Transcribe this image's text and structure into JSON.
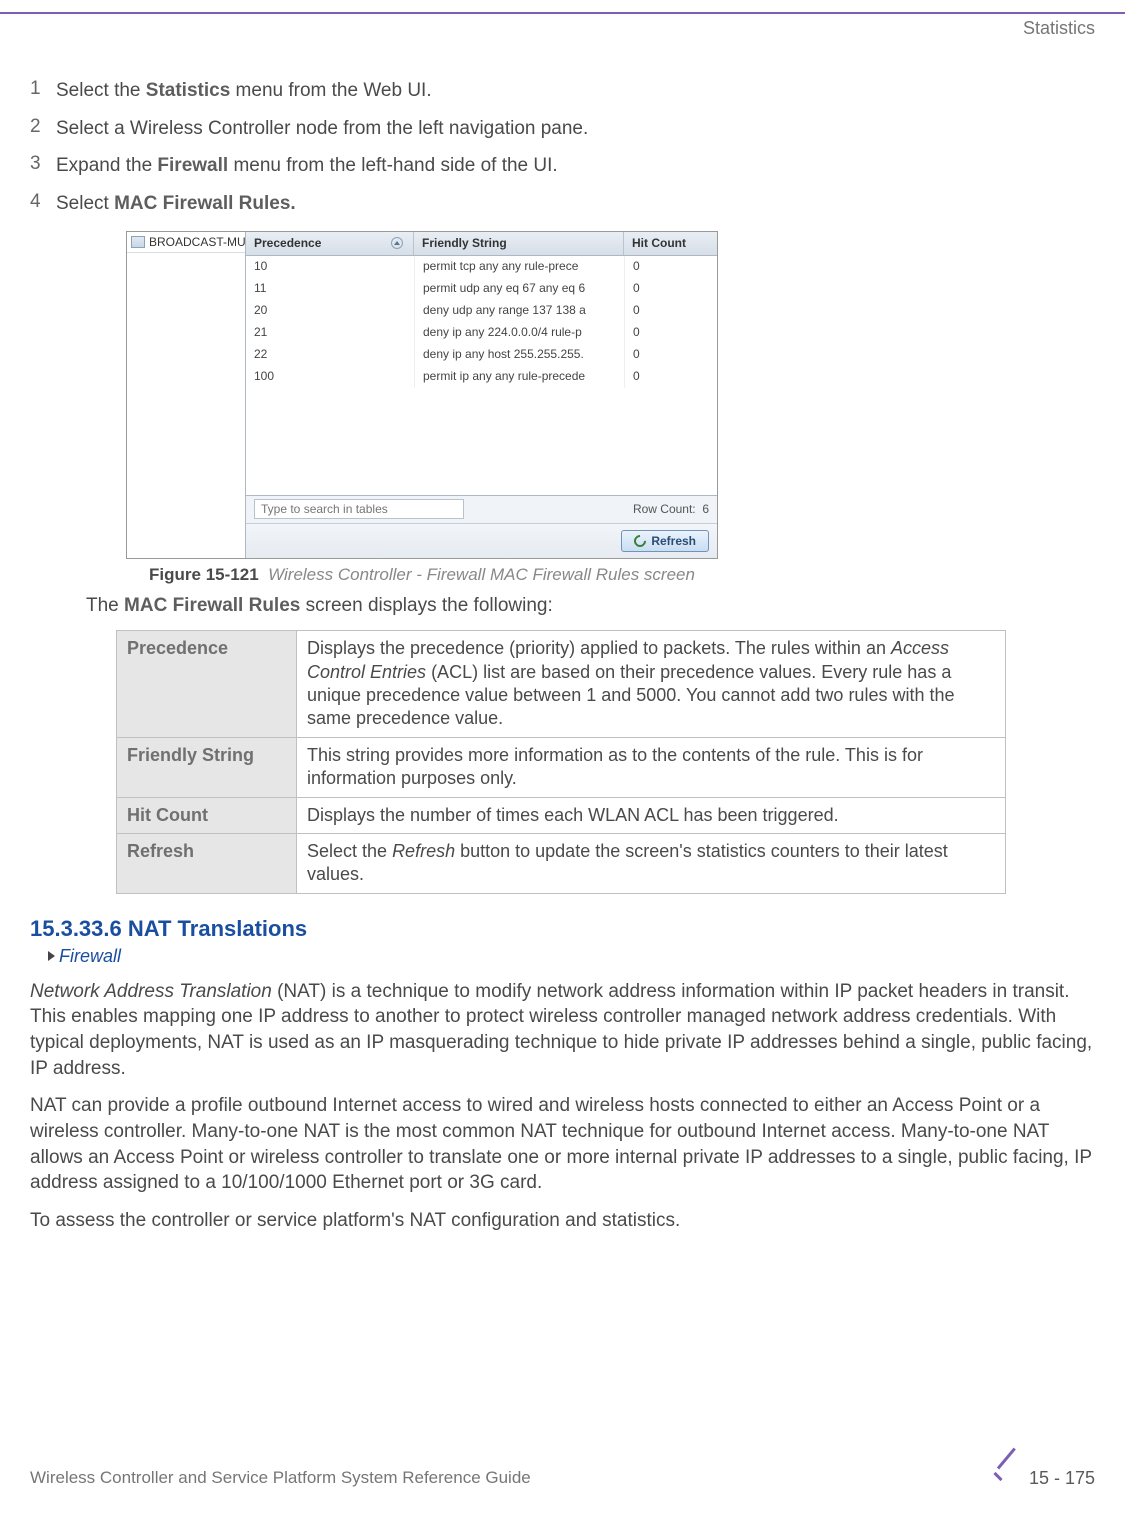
{
  "header": {
    "category": "Statistics"
  },
  "steps": [
    {
      "n": "1",
      "pre": "Select the ",
      "bold": "Statistics",
      "post": " menu from the Web UI."
    },
    {
      "n": "2",
      "pre": "Select a Wireless Controller node from the left navigation pane.",
      "bold": "",
      "post": ""
    },
    {
      "n": "3",
      "pre": "Expand the ",
      "bold": "Firewall",
      "post": " menu from the left-hand side of the UI."
    },
    {
      "n": "4",
      "pre": "Select ",
      "bold": "MAC Firewall Rules.",
      "post": ""
    }
  ],
  "figure": {
    "tree_item": "BROADCAST-MULTIC",
    "columns": {
      "c1": "Precedence",
      "c2": "Friendly String",
      "c3": "Hit Count"
    },
    "rows": [
      {
        "p": "10",
        "f": "permit tcp any any rule-prece",
        "h": "0"
      },
      {
        "p": "11",
        "f": "permit udp any eq 67 any eq 6",
        "h": "0"
      },
      {
        "p": "20",
        "f": "deny udp any range 137 138 a",
        "h": "0"
      },
      {
        "p": "21",
        "f": "deny ip any 224.0.0.0/4 rule-p",
        "h": "0"
      },
      {
        "p": "22",
        "f": "deny ip any host 255.255.255.",
        "h": "0"
      },
      {
        "p": "100",
        "f": "permit ip any any rule-precede",
        "h": "0"
      }
    ],
    "search_placeholder": "Type to search in tables",
    "rowcount_label": "Row Count:",
    "rowcount_value": "6",
    "refresh_label": "Refresh",
    "caption_bold": "Figure 15-121",
    "caption_ital": "Wireless Controller - Firewall MAC Firewall Rules screen"
  },
  "intro_para": {
    "pre": "The ",
    "bold": "MAC Firewall Rules",
    "post": " screen displays the following:"
  },
  "definitions": [
    {
      "term": "Precedence",
      "desc": "Displays the precedence (priority) applied to packets. The rules within an Access Control Entries (ACL) list are based on their precedence values. Every rule has a unique precedence value between 1 and 5000. You cannot add two rules with the same precedence value.",
      "ital_phrase": "Access Control Entries"
    },
    {
      "term": "Friendly String",
      "desc": "This string provides more information as to the contents of the rule. This is for information purposes only."
    },
    {
      "term": "Hit Count",
      "desc": "Displays the number of times each WLAN ACL has been triggered."
    },
    {
      "term": "Refresh",
      "desc": "Select the Refresh button to update the screen's statistics counters to their latest values.",
      "ital_phrase": "Refresh"
    }
  ],
  "section": {
    "number_title": "15.3.33.6  NAT Translations",
    "breadcrumb": "Firewall"
  },
  "body_paras": [
    "Network Address Translation (NAT) is a technique to modify network address information within IP packet headers in transit. This enables mapping one IP address to another to protect wireless controller managed network address credentials. With typical deployments, NAT is used as an IP masquerading technique to hide private IP addresses behind a single, public facing, IP address.",
    "NAT can provide a profile outbound Internet access to wired and wireless hosts connected to either an Access Point or a wireless controller. Many-to-one NAT is the most common NAT technique for outbound Internet access. Many-to-one NAT allows an Access Point or wireless controller to translate one or more internal private IP addresses to a single, public facing, IP address assigned to a 10/100/1000 Ethernet port or 3G card.",
    "To assess the controller or service platform's NAT configuration and statistics."
  ],
  "body_para_1_ital": "Network Address Translation",
  "footer": {
    "guide": "Wireless Controller and Service Platform System Reference Guide",
    "page": "15 - 175"
  }
}
